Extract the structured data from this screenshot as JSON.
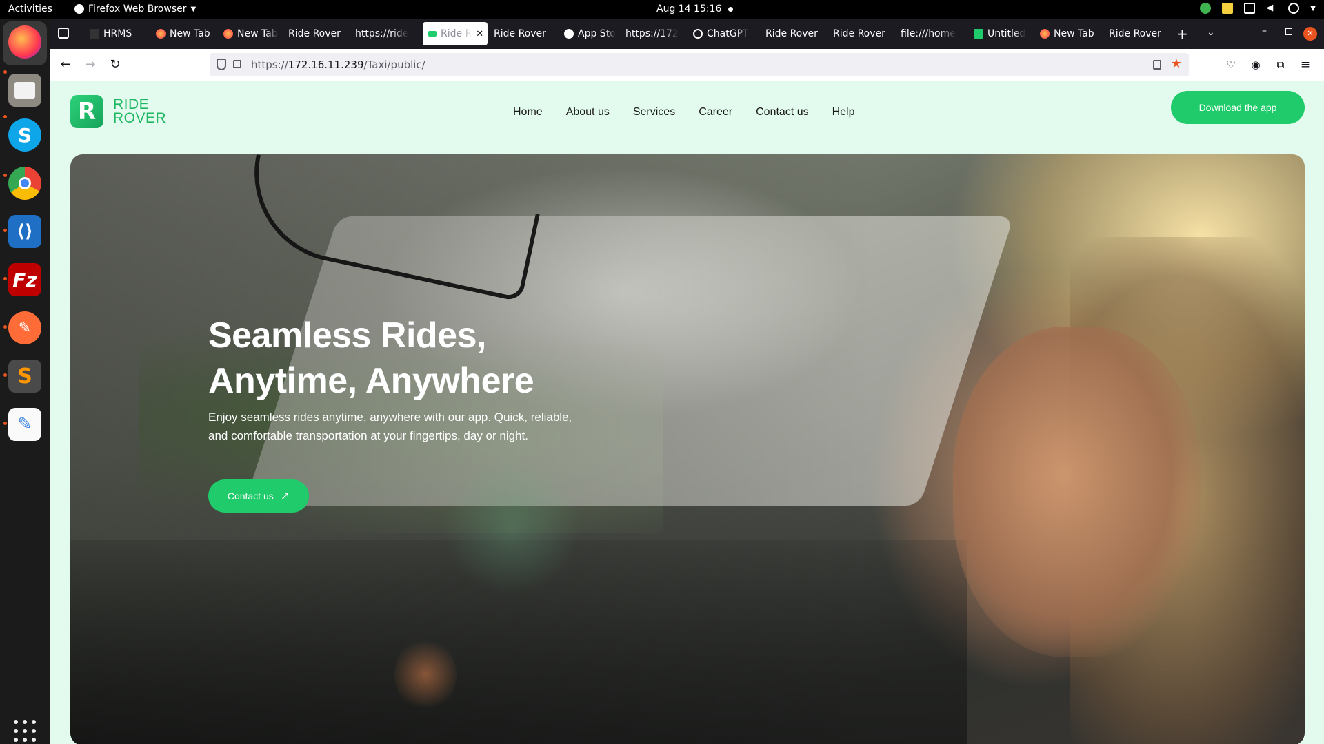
{
  "topbar": {
    "activities": "Activities",
    "app_name": "Firefox Web Browser",
    "clock": "Aug 14  15:16"
  },
  "dock": {
    "items": [
      "firefox-icon",
      "files-icon",
      "skype-icon",
      "chrome-icon",
      "vscode-icon",
      "filezilla-icon",
      "postman-icon",
      "sublime-icon",
      "text-editor-icon"
    ],
    "show_apps_icon": "grid-icon"
  },
  "tabs": [
    {
      "label": "HRMS"
    },
    {
      "label": "New Tab"
    },
    {
      "label": "New Tab"
    },
    {
      "label": "Ride Rover"
    },
    {
      "label": "https://ride"
    },
    {
      "label": "Ride R",
      "active": true
    },
    {
      "label": "Ride Rover"
    },
    {
      "label": "App Sto"
    },
    {
      "label": "https://172"
    },
    {
      "label": "ChatGPT"
    },
    {
      "label": "Ride Rover"
    },
    {
      "label": "Ride Rover"
    },
    {
      "label": "file:///home"
    },
    {
      "label": "Untitled"
    },
    {
      "label": "New Tab"
    },
    {
      "label": "Ride Rover"
    }
  ],
  "urlbar": {
    "scheme": "https://",
    "host": "172.16.11.239",
    "path": "/Taxi/public/"
  },
  "site": {
    "logo_line1": "RIDE",
    "logo_line2": "ROVER",
    "logo_mark": "R",
    "nav": [
      "Home",
      "About us",
      "Services",
      "Career",
      "Contact us",
      "Help"
    ],
    "download_btn": "Download the app",
    "hero": {
      "title_line1": "Seamless Rides,",
      "title_line2": "Anytime, Anywhere",
      "subtitle": "Enjoy seamless rides anytime, anywhere with our app. Quick, reliable, and comfortable transportation at your fingertips, day or night.",
      "cta": "Contact us"
    }
  },
  "colors": {
    "brand_green": "#1fcb6a",
    "page_bg": "#e3fbee",
    "tabstrip_bg": "#1c1b22"
  }
}
